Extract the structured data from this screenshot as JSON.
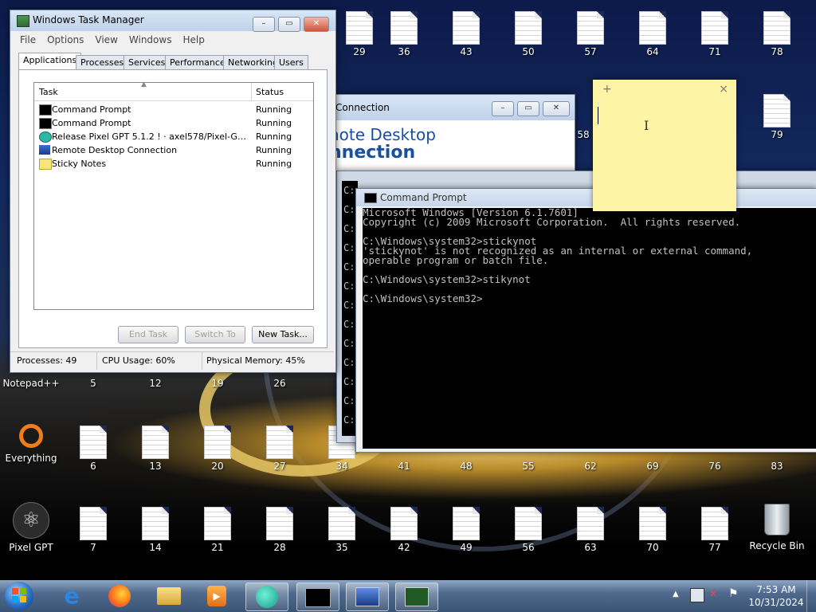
{
  "desktop": {
    "top_row": [
      "29",
      "36",
      "43",
      "50",
      "57",
      "64",
      "71",
      "78"
    ],
    "row2_right": [
      "58",
      "79"
    ],
    "row_mid_labels": [
      "Notepad++",
      "5",
      "12",
      "19",
      "26"
    ],
    "row3": [
      "Everything",
      "6",
      "13",
      "20",
      "27",
      "34",
      "41",
      "48",
      "55",
      "62",
      "69",
      "76",
      "83"
    ],
    "row4": [
      "Pixel GPT",
      "7",
      "14",
      "21",
      "28",
      "35",
      "42",
      "49",
      "56",
      "63",
      "70",
      "77",
      "Recycle Bin"
    ]
  },
  "task_manager": {
    "title": "Windows Task Manager",
    "menu": [
      "File",
      "Options",
      "View",
      "Windows",
      "Help"
    ],
    "tabs": [
      "Applications",
      "Processes",
      "Services",
      "Performance",
      "Networking",
      "Users"
    ],
    "col_task": "Task",
    "col_status": "Status",
    "rows": [
      {
        "task": "Command Prompt",
        "status": "Running"
      },
      {
        "task": "Command Prompt",
        "status": "Running"
      },
      {
        "task": "Release Pixel GPT 5.1.2 ! · axel578/Pixel-GPT · ...",
        "status": "Running"
      },
      {
        "task": "Remote Desktop Connection",
        "status": "Running"
      },
      {
        "task": "Sticky Notes",
        "status": "Running"
      }
    ],
    "btn_end": "End Task",
    "btn_switch": "Switch To",
    "btn_new": "New Task...",
    "status_processes": "Processes: 49",
    "status_cpu": "CPU Usage: 60%",
    "status_mem": "Physical Memory: 45%"
  },
  "rdc": {
    "title_partial": "Connection",
    "heading1": "note Desktop",
    "heading2": "nnection"
  },
  "cmd": {
    "title": "Command Prompt",
    "lines": [
      "Microsoft Windows [Version 6.1.7601]",
      "Copyright (c) 2009 Microsoft Corporation.  All rights reserved.",
      "",
      "C:\\Windows\\system32>stickynot",
      "'stickynot' is not recognized as an internal or external command,",
      "operable program or batch file.",
      "",
      "C:\\Windows\\system32>stikynot",
      "",
      "C:\\Windows\\system32>"
    ],
    "back_prompt": "C:"
  },
  "sticky": {
    "add": "+",
    "close": "×"
  },
  "taskbar": {
    "time": "7:53 AM",
    "date": "10/31/2024"
  },
  "colors": {
    "sticky": "#fdf5a5",
    "taskbar": "#4f6a8e",
    "accent": "#1a4fa0"
  }
}
